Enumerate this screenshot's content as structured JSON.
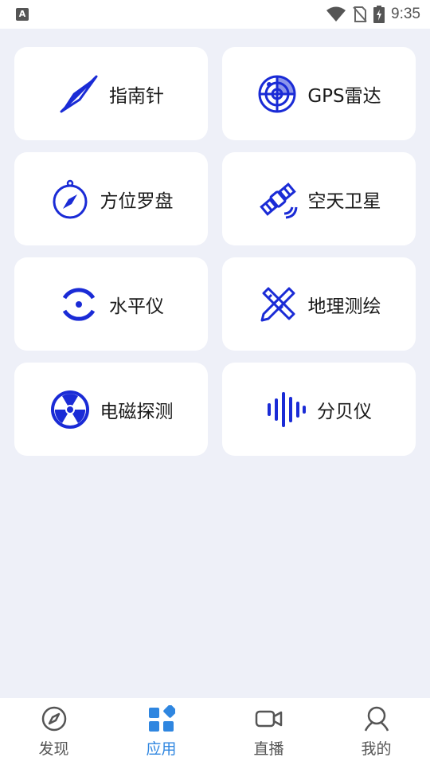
{
  "status_bar": {
    "time": "9:35",
    "app_badge": "A"
  },
  "colors": {
    "icon_blue": "#1a2bd6",
    "tab_active": "#2f86e0",
    "tab_inactive": "#555555",
    "background": "#eef0f8"
  },
  "cards": [
    {
      "label": "指南针",
      "icon": "compass-needle-icon"
    },
    {
      "label": "GPS雷达",
      "icon": "radar-icon"
    },
    {
      "label": "方位罗盘",
      "icon": "compass-dial-icon"
    },
    {
      "label": "空天卫星",
      "icon": "satellite-icon"
    },
    {
      "label": "水平仪",
      "icon": "level-icon"
    },
    {
      "label": "地理测绘",
      "icon": "ruler-pencil-icon"
    },
    {
      "label": "电磁探测",
      "icon": "radiation-icon"
    },
    {
      "label": "分贝仪",
      "icon": "sound-wave-icon"
    }
  ],
  "tabs": [
    {
      "label": "发现",
      "icon": "compass-outline-icon",
      "active": false
    },
    {
      "label": "应用",
      "icon": "apps-grid-icon",
      "active": true
    },
    {
      "label": "直播",
      "icon": "video-camera-icon",
      "active": false
    },
    {
      "label": "我的",
      "icon": "user-icon",
      "active": false
    }
  ]
}
